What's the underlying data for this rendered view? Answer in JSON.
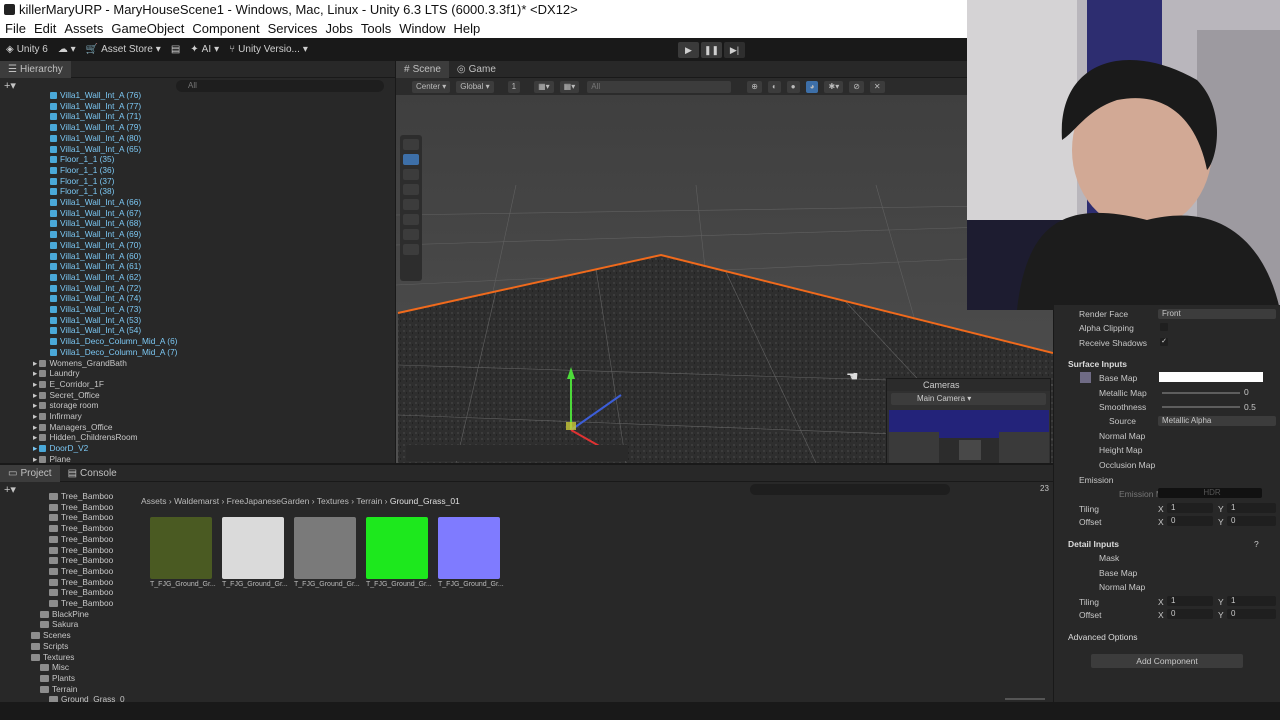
{
  "title": "killerMaryURP - MaryHouseScene1 - Windows, Mac, Linux - Unity 6.3 LTS (6000.3.3f1)* <DX12>",
  "menu": [
    "File",
    "Edit",
    "Assets",
    "GameObject",
    "Component",
    "Services",
    "Jobs",
    "Tools",
    "Window",
    "Help"
  ],
  "toolbar": {
    "unity": "Unity 6",
    "assetstore": "Asset Store",
    "ai": "AI",
    "version": "Unity Versio..."
  },
  "hierarchy": {
    "tab": "Hierarchy",
    "search_placeholder": "All",
    "items": [
      {
        "label": "Villa1_Wall_Int_A (76)",
        "color": "blue",
        "indent": 1
      },
      {
        "label": "Villa1_Wall_Int_A (77)",
        "color": "blue",
        "indent": 1
      },
      {
        "label": "Villa1_Wall_Int_A (71)",
        "color": "blue",
        "indent": 1
      },
      {
        "label": "Villa1_Wall_Int_A (79)",
        "color": "blue",
        "indent": 1
      },
      {
        "label": "Villa1_Wall_Int_A (80)",
        "color": "blue",
        "indent": 1
      },
      {
        "label": "Villa1_Wall_Int_A (65)",
        "color": "blue",
        "indent": 1
      },
      {
        "label": "Floor_1_1 (35)",
        "color": "blue",
        "indent": 1
      },
      {
        "label": "Floor_1_1 (36)",
        "color": "blue",
        "indent": 1
      },
      {
        "label": "Floor_1_1 (37)",
        "color": "blue",
        "indent": 1
      },
      {
        "label": "Floor_1_1 (38)",
        "color": "blue",
        "indent": 1
      },
      {
        "label": "Villa1_Wall_Int_A (66)",
        "color": "blue",
        "indent": 1
      },
      {
        "label": "Villa1_Wall_Int_A (67)",
        "color": "blue",
        "indent": 1
      },
      {
        "label": "Villa1_Wall_Int_A (68)",
        "color": "blue",
        "indent": 1
      },
      {
        "label": "Villa1_Wall_Int_A (69)",
        "color": "blue",
        "indent": 1
      },
      {
        "label": "Villa1_Wall_Int_A (70)",
        "color": "blue",
        "indent": 1
      },
      {
        "label": "Villa1_Wall_Int_A (60)",
        "color": "blue",
        "indent": 1
      },
      {
        "label": "Villa1_Wall_Int_A (61)",
        "color": "blue",
        "indent": 1
      },
      {
        "label": "Villa1_Wall_Int_A (62)",
        "color": "blue",
        "indent": 1
      },
      {
        "label": "Villa1_Wall_Int_A (72)",
        "color": "blue",
        "indent": 1
      },
      {
        "label": "Villa1_Wall_Int_A (74)",
        "color": "blue",
        "indent": 1
      },
      {
        "label": "Villa1_Wall_Int_A (73)",
        "color": "blue",
        "indent": 1
      },
      {
        "label": "Villa1_Wall_Int_A (53)",
        "color": "blue",
        "indent": 1
      },
      {
        "label": "Villa1_Wall_Int_A (54)",
        "color": "blue",
        "indent": 1
      },
      {
        "label": "Villa1_Deco_Column_Mid_A (6)",
        "color": "blue",
        "indent": 1
      },
      {
        "label": "Villa1_Deco_Column_Mid_A (7)",
        "color": "blue",
        "indent": 1
      },
      {
        "label": "Womens_GrandBath",
        "color": "grey",
        "indent": 0
      },
      {
        "label": "Laundry",
        "color": "grey",
        "indent": 0
      },
      {
        "label": "E_Corridor_1F",
        "color": "grey",
        "indent": 0
      },
      {
        "label": "Secret_Office",
        "color": "grey",
        "indent": 0
      },
      {
        "label": "storage room",
        "color": "grey",
        "indent": 0
      },
      {
        "label": "Infirmary",
        "color": "grey",
        "indent": 0
      },
      {
        "label": "Managers_Office",
        "color": "grey",
        "indent": 0
      },
      {
        "label": "Hidden_ChildrensRoom",
        "color": "grey",
        "indent": 0
      },
      {
        "label": "DoorD_V2",
        "color": "blue",
        "indent": 0
      },
      {
        "label": "Plane",
        "color": "grey",
        "indent": 0
      }
    ]
  },
  "scene": {
    "tabs": [
      "Scene",
      "Game"
    ],
    "pivot": "Center",
    "space": "Global",
    "snap": "1",
    "search_placeholder": "All"
  },
  "cameras": {
    "title": "Cameras",
    "selected": "Main Camera"
  },
  "inspector": {
    "render_face_label": "Render Face",
    "render_face_value": "Front",
    "alpha_clipping": "Alpha Clipping",
    "receive_shadows": "Receive Shadows",
    "surface_inputs": "Surface Inputs",
    "base_map": "Base Map",
    "metallic_map": "Metallic Map",
    "metallic_value": "0",
    "smoothness": "Smoothness",
    "smoothness_value": "0.5",
    "source": "Source",
    "source_value": "Metallic Alpha",
    "normal_map": "Normal Map",
    "height_map": "Height Map",
    "occlusion_map": "Occlusion Map",
    "emission": "Emission",
    "emission_map": "Emission M",
    "emission_hdr": "HDR",
    "tiling": "Tiling",
    "offset": "Offset",
    "x": "X",
    "y": "Y",
    "tiling_x": "1",
    "tiling_y": "1",
    "offset_x": "0",
    "offset_y": "0",
    "detail_inputs": "Detail Inputs",
    "mask": "Mask",
    "detail_base_map": "Base Map",
    "detail_normal_map": "Normal Map",
    "detail_tiling_x": "1",
    "detail_tiling_y": "1",
    "detail_offset_x": "0",
    "detail_offset_y": "0",
    "advanced": "Advanced Options",
    "add_component": "Add Component"
  },
  "project": {
    "tabs": [
      "Project",
      "Console"
    ],
    "count": "23",
    "tree": [
      {
        "label": "Tree_Bamboo",
        "indent": 3
      },
      {
        "label": "Tree_Bamboo",
        "indent": 3
      },
      {
        "label": "Tree_Bamboo",
        "indent": 3
      },
      {
        "label": "Tree_Bamboo",
        "indent": 3
      },
      {
        "label": "Tree_Bamboo",
        "indent": 3
      },
      {
        "label": "Tree_Bamboo",
        "indent": 3
      },
      {
        "label": "Tree_Bamboo",
        "indent": 3
      },
      {
        "label": "Tree_Bamboo",
        "indent": 3
      },
      {
        "label": "Tree_Bamboo",
        "indent": 3
      },
      {
        "label": "Tree_Bamboo",
        "indent": 3
      },
      {
        "label": "Tree_Bamboo",
        "indent": 3
      },
      {
        "label": "BlackPine",
        "indent": 2
      },
      {
        "label": "Sakura",
        "indent": 2
      },
      {
        "label": "Scenes",
        "indent": 1
      },
      {
        "label": "Scripts",
        "indent": 1
      },
      {
        "label": "Textures",
        "indent": 1
      },
      {
        "label": "Misc",
        "indent": 2
      },
      {
        "label": "Plants",
        "indent": 2
      },
      {
        "label": "Terrain",
        "indent": 2
      },
      {
        "label": "Ground_Grass_0",
        "indent": 3
      }
    ],
    "breadcrumb": [
      "Assets",
      "Waldemarst",
      "FreeJapaneseGarden",
      "Textures",
      "Terrain",
      "Ground_Grass_01"
    ],
    "assets": [
      {
        "label": "T_FJG_Ground_Gr...",
        "color": "#4a5a22"
      },
      {
        "label": "T_FJG_Ground_Gr...",
        "color": "#dadada"
      },
      {
        "label": "T_FJG_Ground_Gr...",
        "color": "#7a7a7a"
      },
      {
        "label": "T_FJG_Ground_Gr...",
        "color": "#1de81d"
      },
      {
        "label": "T_FJG_Ground_Gr...",
        "color": "#7f7bff"
      }
    ]
  }
}
